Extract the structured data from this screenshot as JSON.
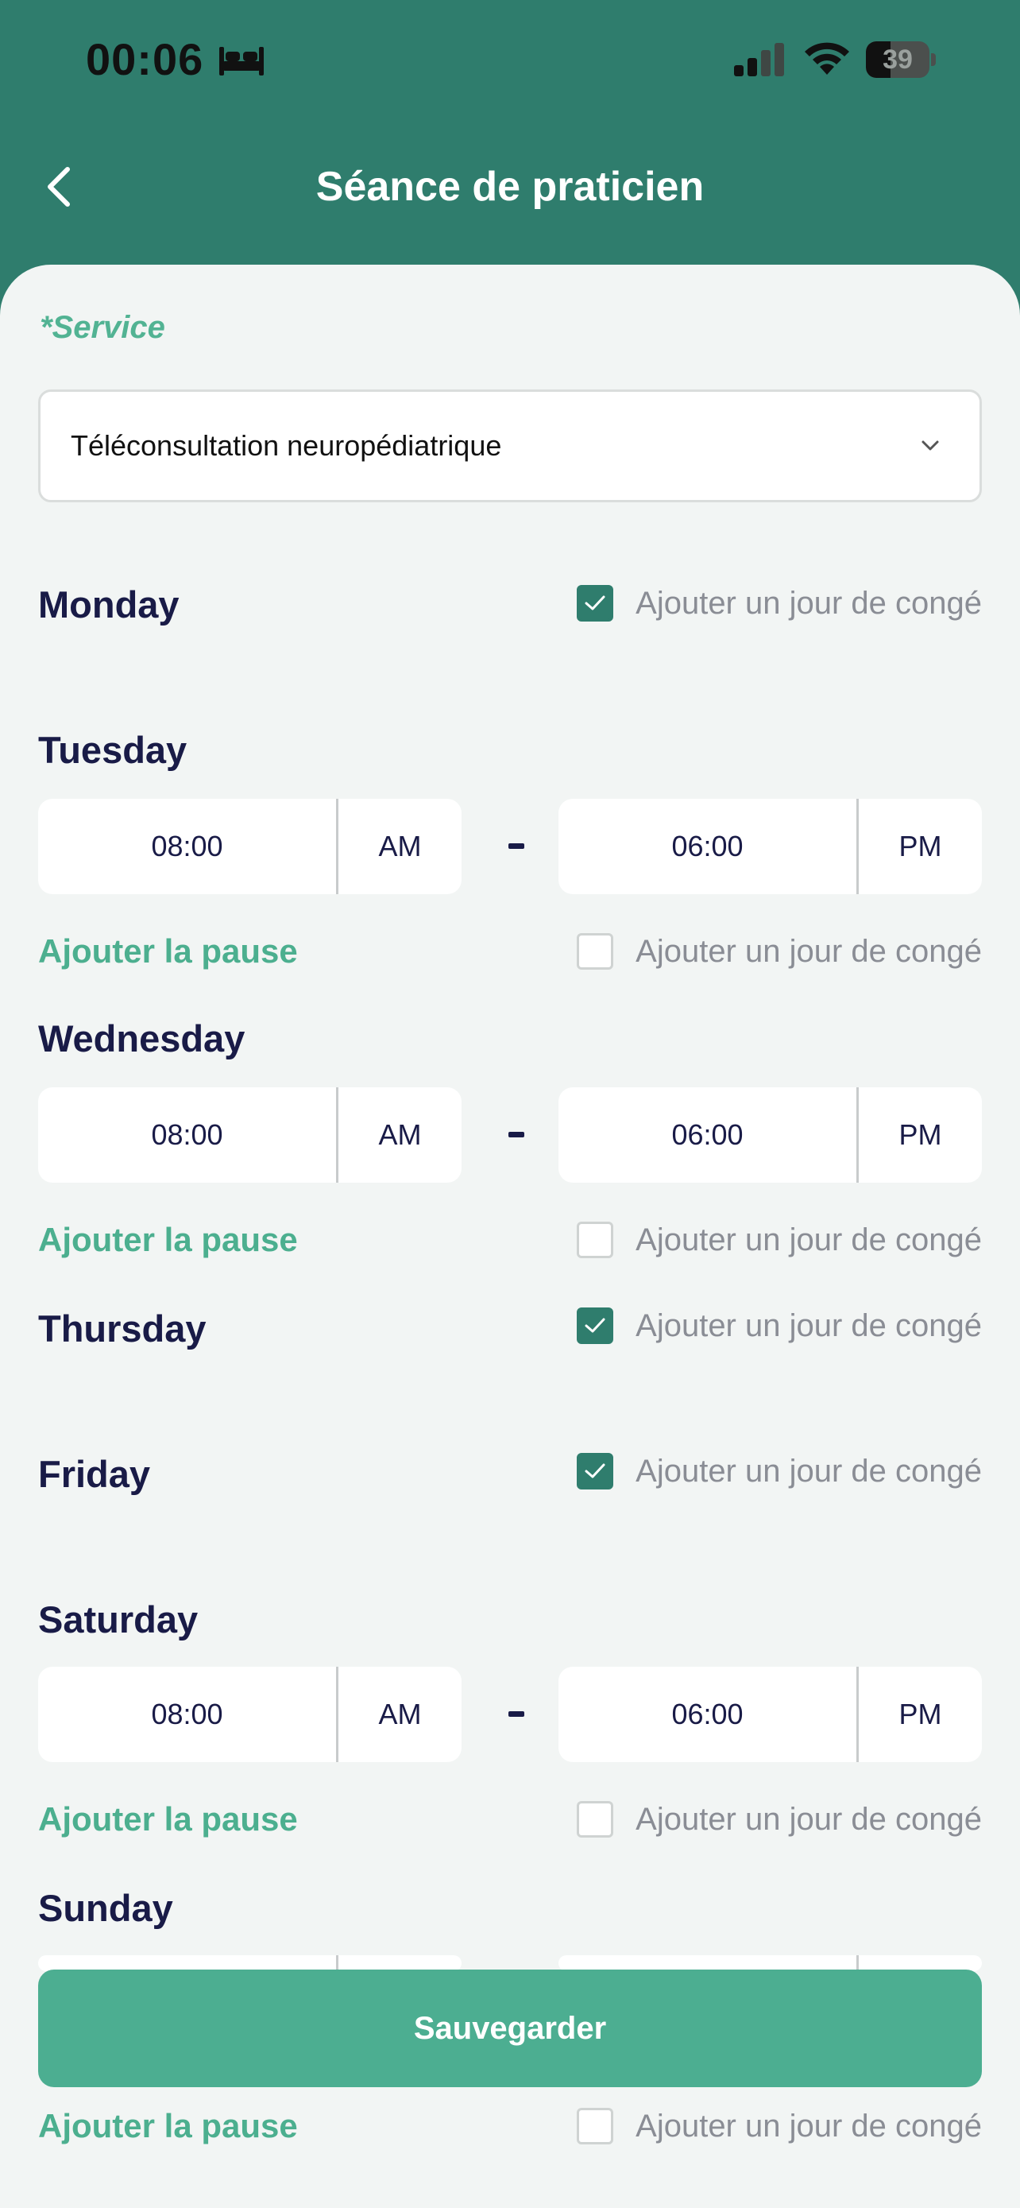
{
  "status_bar": {
    "time": "00:06",
    "battery_level": "39",
    "icons": [
      "bed-icon",
      "signal-icon",
      "wifi-icon",
      "battery-icon"
    ]
  },
  "header": {
    "title": "Séance de praticien",
    "back_icon": "chevron-left-icon"
  },
  "service": {
    "label": "*Service",
    "value": "Téléconsultation neuropédiatrique"
  },
  "days": [
    {
      "name": "Monday",
      "holiday_checked": true,
      "holiday_label": "Ajouter un jour de congé"
    },
    {
      "name": "Tuesday",
      "holiday_checked": false,
      "holiday_label": "Ajouter un jour de congé",
      "start_time": "08:00",
      "start_ampm": "AM",
      "end_time": "06:00",
      "end_ampm": "PM",
      "pause_label": "Ajouter la pause"
    },
    {
      "name": "Wednesday",
      "holiday_checked": false,
      "holiday_label": "Ajouter un jour de congé",
      "start_time": "08:00",
      "start_ampm": "AM",
      "end_time": "06:00",
      "end_ampm": "PM",
      "pause_label": "Ajouter la pause"
    },
    {
      "name": "Thursday",
      "holiday_checked": true,
      "holiday_label": "Ajouter un jour de congé"
    },
    {
      "name": "Friday",
      "holiday_checked": true,
      "holiday_label": "Ajouter un jour de congé"
    },
    {
      "name": "Saturday",
      "holiday_checked": false,
      "holiday_label": "Ajouter un jour de congé",
      "start_time": "08:00",
      "start_ampm": "AM",
      "end_time": "06:00",
      "end_ampm": "PM",
      "pause_label": "Ajouter la pause"
    },
    {
      "name": "Sunday",
      "holiday_checked": false,
      "holiday_label": "Ajouter un jour de congé",
      "pause_label": "Ajouter la pause"
    }
  ],
  "save_button": {
    "label": "Sauvegarder"
  },
  "colors": {
    "header_bg": "#2f7d6d",
    "accent": "#4cae91",
    "day_text": "#191b47",
    "sheet_bg": "#f2f5f4"
  }
}
